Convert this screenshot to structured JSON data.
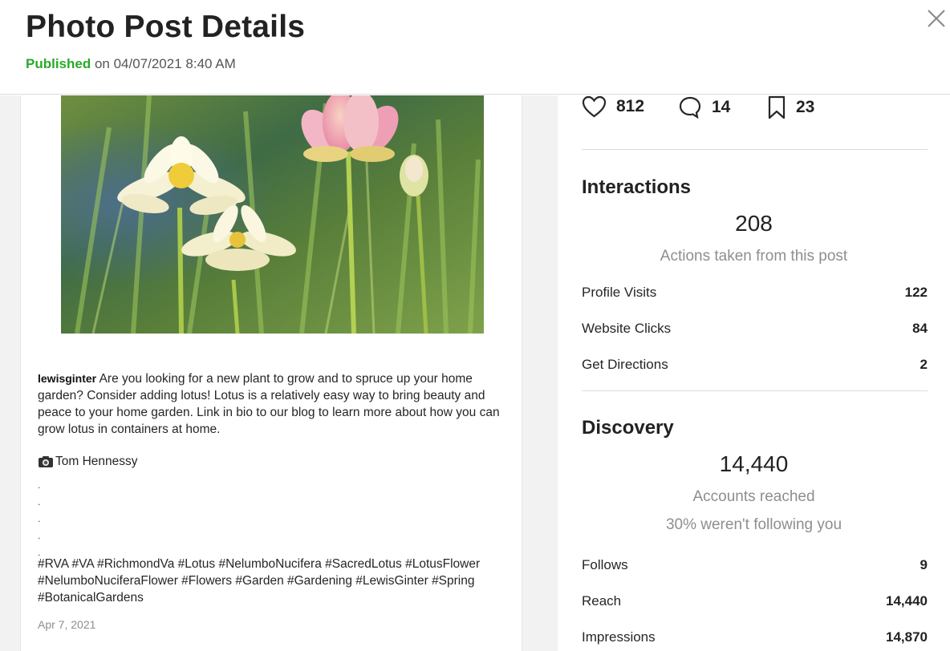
{
  "header": {
    "title": "Photo Post Details",
    "status": "Published",
    "date_text": " on 04/07/2021 8:40 AM"
  },
  "post": {
    "username": "lewisginter",
    "caption": "Are you looking for a new plant to grow and to spruce up your home garden? Consider adding lotus! Lotus is a relatively easy way to bring beauty and peace to your home garden. Link in bio to our blog to learn more about how you can grow lotus in containers at home.",
    "credit_icon": "camera-icon",
    "credit": "Tom Hennessy",
    "dots": [
      ".",
      ".",
      ".",
      ".",
      "."
    ],
    "hashtags": "#RVA #VA #RichmondVa #Lotus #NelumboNucifera #SacredLotus #LotusFlower #NelumboNuciferaFlower #Flowers #Garden #Gardening #LewisGinter #Spring #BotanicalGardens",
    "date": "Apr 7, 2021"
  },
  "engagement": {
    "likes": "812",
    "comments": "14",
    "saves": "23"
  },
  "interactions": {
    "title": "Interactions",
    "total": "208",
    "description": "Actions taken from this post",
    "rows": [
      {
        "label": "Profile Visits",
        "value": "122"
      },
      {
        "label": "Website Clicks",
        "value": "84"
      },
      {
        "label": "Get Directions",
        "value": "2"
      }
    ]
  },
  "discovery": {
    "title": "Discovery",
    "total": "14,440",
    "description": "Accounts reached",
    "note": "30% weren't following you",
    "rows": [
      {
        "label": "Follows",
        "value": "9"
      },
      {
        "label": "Reach",
        "value": "14,440"
      },
      {
        "label": "Impressions",
        "value": "14,870"
      }
    ]
  },
  "colors": {
    "published": "#2aa92a",
    "muted": "#8e8e8e",
    "divider": "#dbdbdb"
  }
}
